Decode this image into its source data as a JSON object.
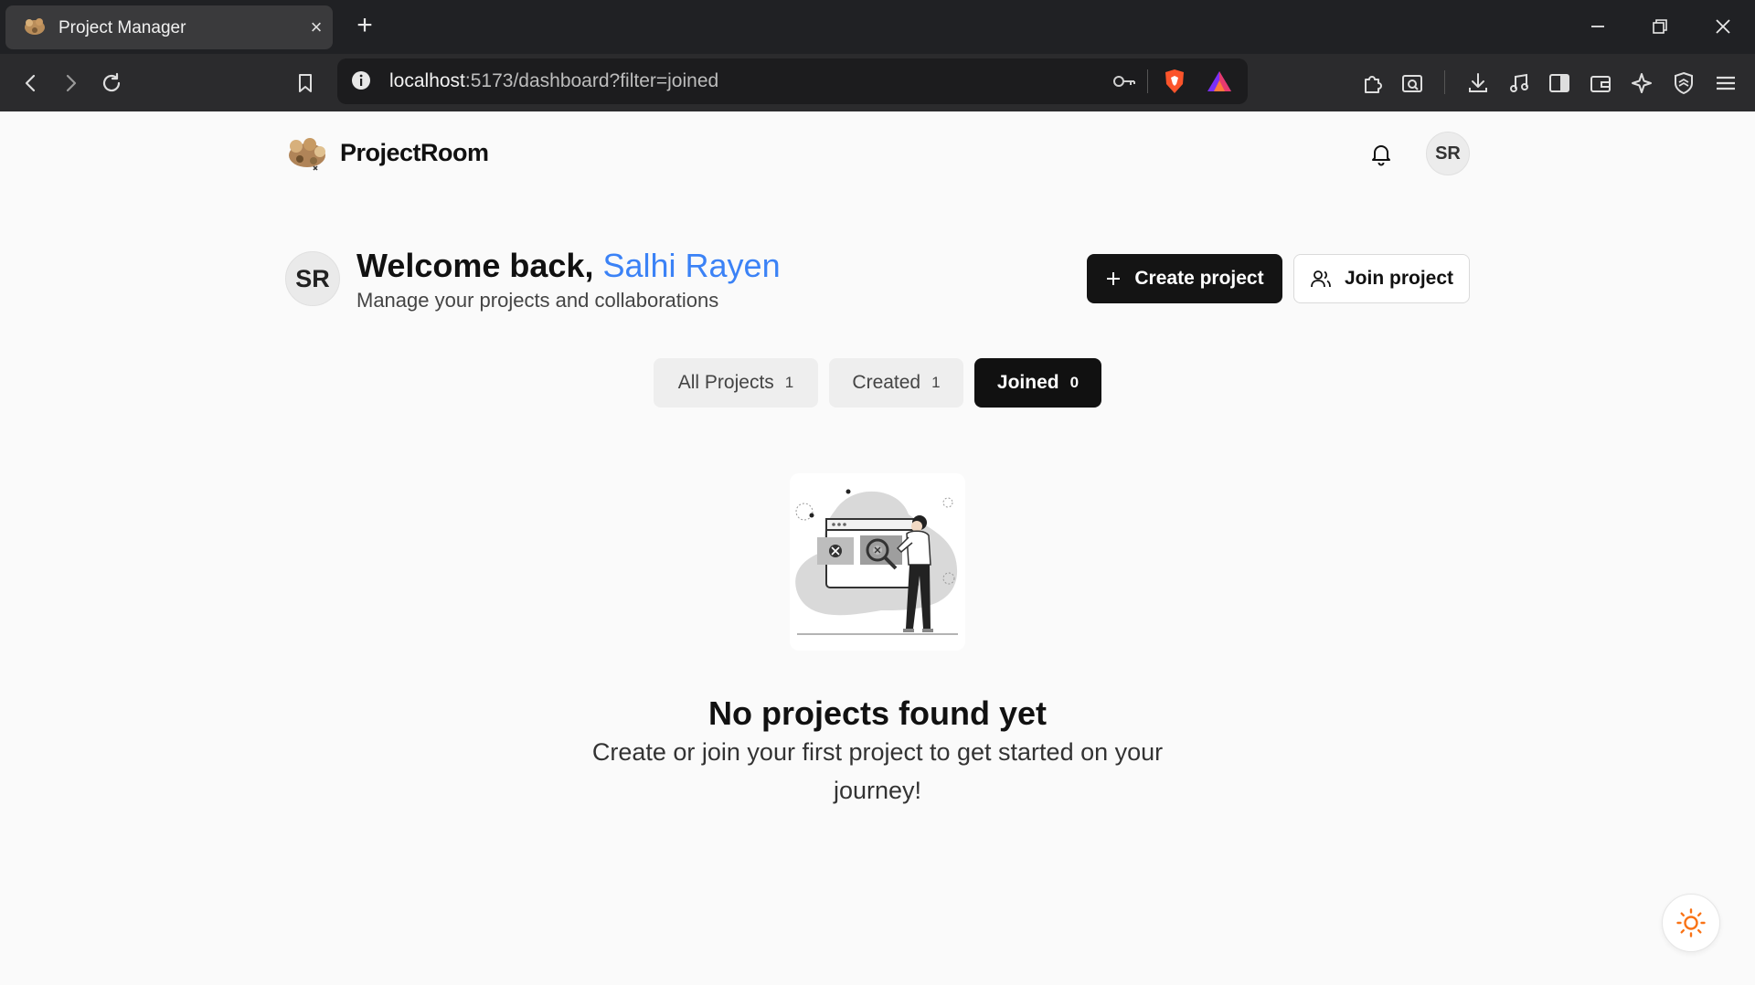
{
  "browser": {
    "tab_title": "Project Manager",
    "url_host": "localhost",
    "url_rest": ":5173/dashboard?filter=joined",
    "icons": [
      "back-icon",
      "forward-icon",
      "reload-icon",
      "bookmark-icon",
      "site-info-icon",
      "key-icon",
      "brave-shield-icon",
      "brave-rewards-icon",
      "extensions-icon",
      "screenshot-icon",
      "download-icon",
      "media-icon",
      "sidebar-icon",
      "wallet-icon",
      "leo-ai-icon",
      "vpn-icon",
      "menu-icon"
    ]
  },
  "header": {
    "logo_text": "ProjectRoom",
    "avatar_initials": "SR"
  },
  "welcome": {
    "avatar_initials": "SR",
    "greeting": "Welcome back, ",
    "user_name": "Salhi Rayen",
    "subtitle": "Manage your projects and collaborations"
  },
  "actions": {
    "create_label": "Create project",
    "join_label": "Join project"
  },
  "filters": [
    {
      "label": "All Projects",
      "count": "1",
      "active": false
    },
    {
      "label": "Created",
      "count": "1",
      "active": false
    },
    {
      "label": "Joined",
      "count": "0",
      "active": true
    }
  ],
  "empty_state": {
    "title": "No projects found yet",
    "subtitle": "Create or join your first project to get started on your journey!"
  },
  "colors": {
    "accent_name": "#3b82f6",
    "primary_button": "#141414",
    "theme_icon": "#f97316"
  }
}
